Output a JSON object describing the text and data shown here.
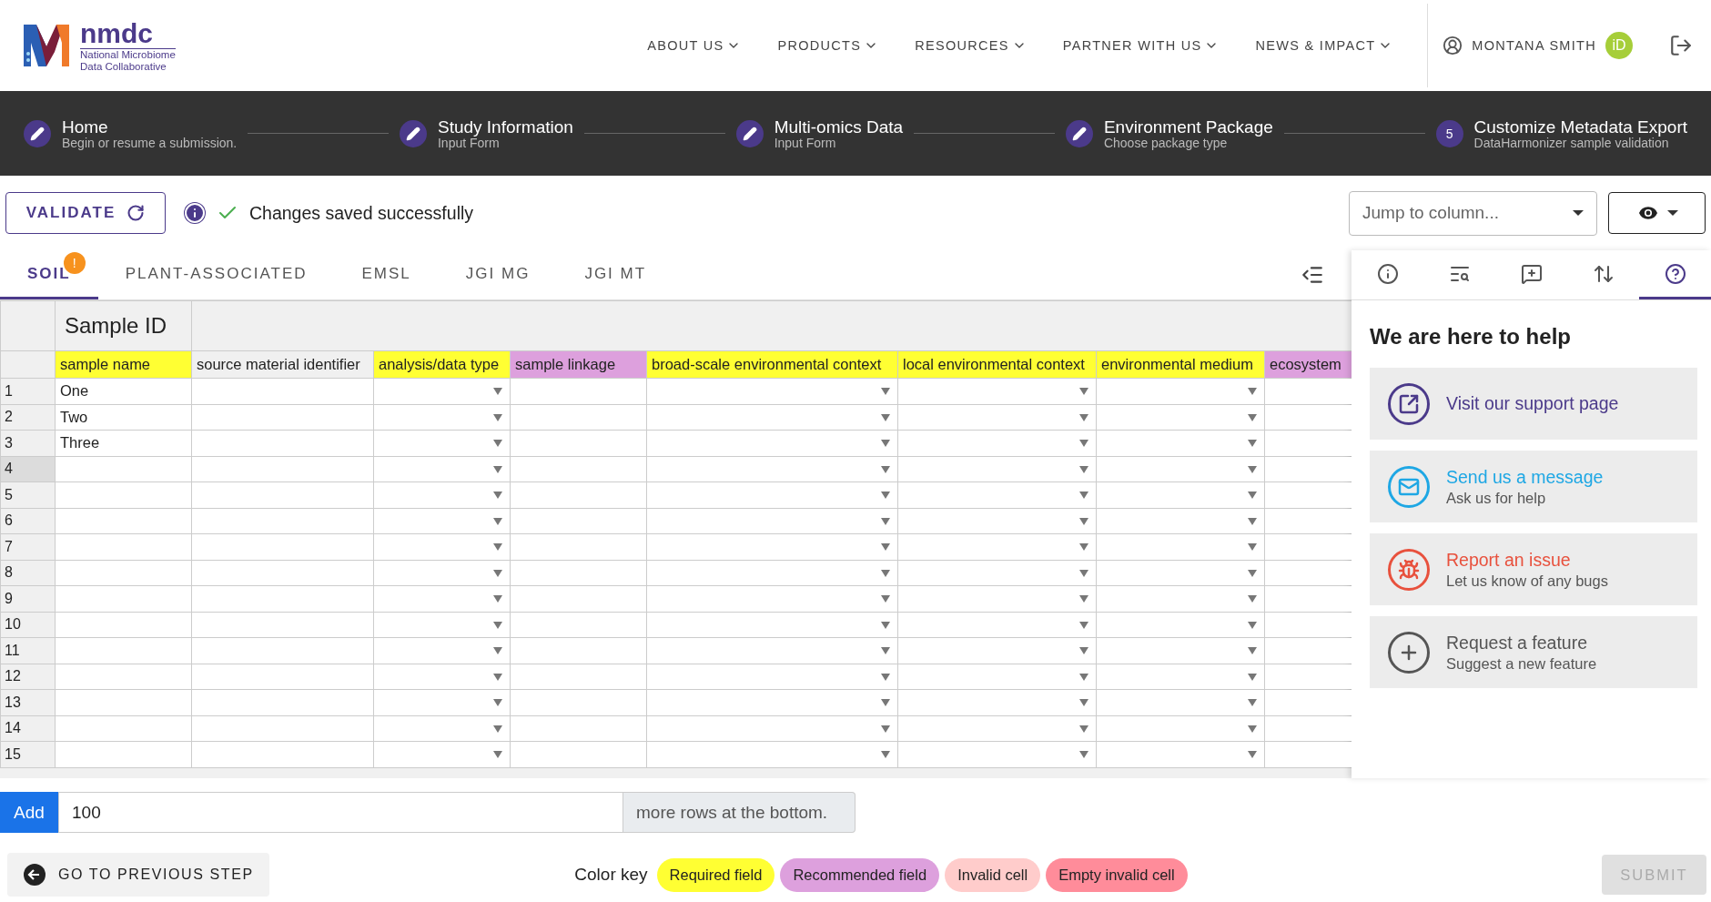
{
  "header": {
    "logo_title": "nmdc",
    "logo_subtitle": [
      "National Microbiome",
      "Data Collaborative"
    ],
    "nav": [
      "ABOUT US",
      "PRODUCTS",
      "RESOURCES",
      "PARTNER WITH US",
      "NEWS & IMPACT"
    ],
    "user": "MONTANA SMITH",
    "orcid_badge": "iD"
  },
  "steps": [
    {
      "kind": "done",
      "title": "Home",
      "subtitle": "Begin or resume a submission."
    },
    {
      "kind": "done",
      "title": "Study Information",
      "subtitle": "Input Form"
    },
    {
      "kind": "done",
      "title": "Multi-omics Data",
      "subtitle": "Input Form"
    },
    {
      "kind": "done",
      "title": "Environment Package",
      "subtitle": "Choose package type"
    },
    {
      "kind": "current",
      "number": "5",
      "title": "Customize Metadata Export",
      "subtitle": "DataHarmonizer sample validation"
    }
  ],
  "toolbar": {
    "validate": "VALIDATE",
    "status": "Changes saved successfully",
    "jump_placeholder": "Jump to column..."
  },
  "tabs": [
    {
      "label": "SOIL",
      "selected": true,
      "badge": "!"
    },
    {
      "label": "PLANT-ASSOCIATED",
      "selected": false
    },
    {
      "label": "EMSL",
      "selected": false
    },
    {
      "label": "JGI MG",
      "selected": false
    },
    {
      "label": "JGI MT",
      "selected": false
    }
  ],
  "side_tabs": [
    {
      "selected": false
    },
    {
      "selected": false
    },
    {
      "selected": false
    },
    {
      "selected": false
    },
    {
      "selected": true
    }
  ],
  "grid": {
    "section": "Sample ID",
    "columns": [
      {
        "label": "sample name",
        "color": "#ffff33",
        "dropdown": false
      },
      {
        "label": "source material identifier",
        "color": "#f0f0f0",
        "dropdown": false
      },
      {
        "label": "analysis/data type",
        "color": "#ffff33",
        "dropdown": true
      },
      {
        "label": "sample linkage",
        "color": "#dda0dd",
        "dropdown": false
      },
      {
        "label": "broad-scale environmental context",
        "color": "#ffff33",
        "dropdown": true
      },
      {
        "label": "local environmental context",
        "color": "#ffff33",
        "dropdown": true
      },
      {
        "label": "environmental medium",
        "color": "#ffff33",
        "dropdown": true
      },
      {
        "label": "ecosystem",
        "color": "#dda0dd",
        "dropdown": false
      }
    ],
    "rows": [
      {
        "number": "1",
        "selected": false,
        "sample_name": "One"
      },
      {
        "number": "2",
        "selected": false,
        "sample_name": "Two"
      },
      {
        "number": "3",
        "selected": false,
        "sample_name": "Three"
      },
      {
        "number": "4",
        "selected": true
      },
      {
        "number": "5",
        "selected": false
      },
      {
        "number": "6",
        "selected": false
      },
      {
        "number": "7",
        "selected": false
      },
      {
        "number": "8",
        "selected": false
      },
      {
        "number": "9",
        "selected": false
      },
      {
        "number": "10",
        "selected": false
      },
      {
        "number": "11",
        "selected": false
      },
      {
        "number": "12",
        "selected": false
      },
      {
        "number": "13",
        "selected": false
      },
      {
        "number": "14",
        "selected": false
      },
      {
        "number": "15",
        "selected": false
      }
    ]
  },
  "help": {
    "title": "We are here to help",
    "items": [
      {
        "title": "Visit our support page",
        "color": "#4b3a8a"
      },
      {
        "title": "Send us a message",
        "subtitle": "Ask us for help",
        "color": "#1ea7e4"
      },
      {
        "title": "Report an issue",
        "subtitle": "Let us know of any bugs",
        "color": "#e8513d"
      },
      {
        "title": "Request a feature",
        "subtitle": "Suggest a new feature",
        "color": "#555555"
      }
    ]
  },
  "add_rows": {
    "button": "Add",
    "value": "100",
    "suffix": "more rows at the bottom."
  },
  "footer": {
    "previous": "GO TO PREVIOUS STEP",
    "color_key_label": "Color key",
    "color_key": [
      {
        "label": "Required field",
        "color": "#ffff33"
      },
      {
        "label": "Recommended field",
        "color": "#dda0dd"
      },
      {
        "label": "Invalid cell",
        "color": "#ffcccb"
      },
      {
        "label": "Empty invalid cell",
        "color": "#ff8c9a"
      }
    ],
    "submit": "SUBMIT",
    "submit_disabled": true
  }
}
